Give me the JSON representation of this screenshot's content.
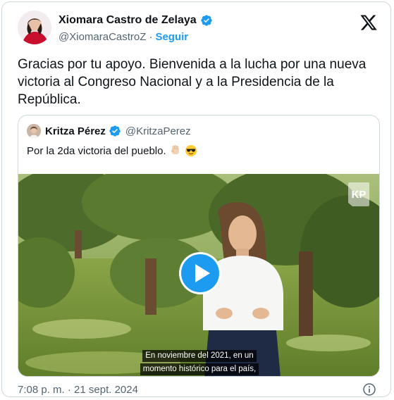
{
  "author": {
    "display_name": "Xiomara Castro de Zelaya",
    "handle": "@XiomaraCastroZ",
    "separator": "·",
    "follow_label": "Seguir"
  },
  "tweet": {
    "text": "Gracias por tu apoyo. Bienvenida a la lucha por una nueva victoria al Congreso Nacional y a la Presidencia de la República."
  },
  "quote": {
    "display_name": "Kritza Pérez",
    "handle": "@KritzaPerez",
    "text": "Por la 2da victoria del pueblo.",
    "emojis": [
      "raised-fist-emoji",
      "sunglasses-emoji"
    ],
    "video": {
      "watermark": "KP",
      "subtitle_line1": "En noviembre del 2021, en un",
      "subtitle_line2": "momento histórico para el país,"
    }
  },
  "footer": {
    "timestamp": "7:08 p. m. · 21 sept. 2024"
  },
  "colors": {
    "accent": "#1d9bf0",
    "verified": "#1d9bf0",
    "secondary_text": "#536471",
    "border": "#cfd9de"
  }
}
